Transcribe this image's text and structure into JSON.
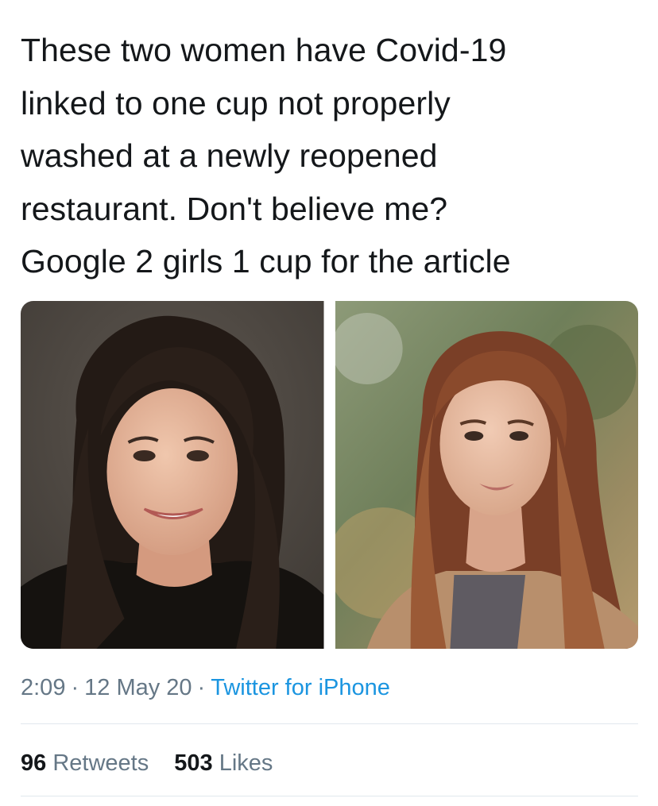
{
  "tweet": {
    "text_lines": [
      "These two women have Covid-19",
      "linked to one cup not properly",
      "washed at a newly reopened",
      "restaurant. Don't believe me?",
      "Google 2 girls 1 cup for the article"
    ],
    "time": "2:09",
    "date": "12 May 20",
    "separator": "·",
    "source": "Twitter for iPhone",
    "stats": {
      "retweets_count": "96",
      "retweets_label": "Retweets",
      "likes_count": "503",
      "likes_label": "Likes"
    },
    "colors": {
      "text": "#14171a",
      "meta": "#657786",
      "link": "#1b95e0",
      "divider": "#e1e8ed"
    }
  }
}
